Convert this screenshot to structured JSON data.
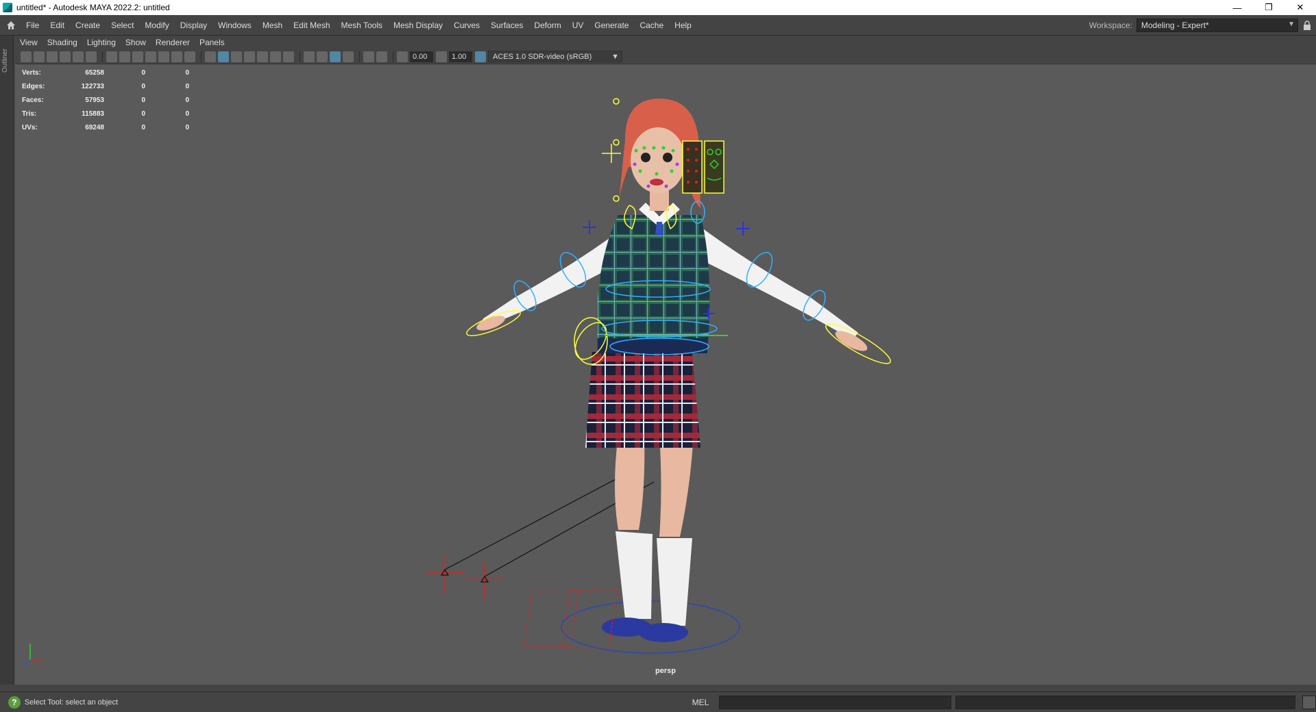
{
  "window": {
    "title": "untitled* - Autodesk MAYA 2022.2: untitled",
    "minimize": "—",
    "restore": "❐",
    "close": "✕"
  },
  "menubar": {
    "items": [
      "File",
      "Edit",
      "Create",
      "Select",
      "Modify",
      "Display",
      "Windows",
      "Mesh",
      "Edit Mesh",
      "Mesh Tools",
      "Mesh Display",
      "Curves",
      "Surfaces",
      "Deform",
      "UV",
      "Generate",
      "Cache",
      "Help"
    ],
    "workspace_label": "Workspace:",
    "workspace_value": "Modeling - Expert*"
  },
  "sideframe": {
    "label": "Outliner"
  },
  "panel": {
    "menu": [
      "View",
      "Shading",
      "Lighting",
      "Show",
      "Renderer",
      "Panels"
    ],
    "exposure": "0.00",
    "gamma": "1.00",
    "color_management": "ACES 1.0 SDR-video (sRGB)"
  },
  "hud": {
    "rows": [
      {
        "label": "Verts:",
        "v1": "65258",
        "v2": "0",
        "v3": "0"
      },
      {
        "label": "Edges:",
        "v1": "122733",
        "v2": "0",
        "v3": "0"
      },
      {
        "label": "Faces:",
        "v1": "57953",
        "v2": "0",
        "v3": "0"
      },
      {
        "label": "Tris:",
        "v1": "115883",
        "v2": "0",
        "v3": "0"
      },
      {
        "label": "UVs:",
        "v1": "69248",
        "v2": "0",
        "v3": "0"
      }
    ]
  },
  "viewport": {
    "camera": "persp"
  },
  "statusbar": {
    "message": "Select Tool: select an object",
    "mel_label": "MEL"
  },
  "colors": {
    "selection_blue": "#5285a6",
    "viewport_bg": "#5a5a5a",
    "rig_yellow": "#ffff33",
    "rig_cyan": "#33b0ff",
    "rig_red": "#e02020"
  }
}
